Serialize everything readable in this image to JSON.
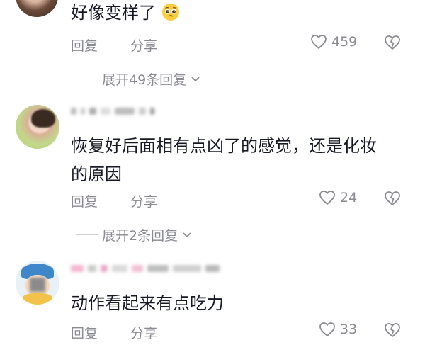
{
  "comments": [
    {
      "text": "好像变样了",
      "emoji": "pleading-face-emoji",
      "reply_label": "回复",
      "share_label": "分享",
      "likes": "459",
      "expand_label": "展开49条回复"
    },
    {
      "text_line1": "恢复好后面相有点凶了的感觉，还是化妆",
      "text_line2": "的原因",
      "reply_label": "回复",
      "share_label": "分享",
      "likes": "24",
      "expand_label": "展开2条回复"
    },
    {
      "text": "动作看起来有点吃力",
      "reply_label": "回复",
      "share_label": "分享",
      "likes": "33"
    }
  ],
  "colors": {
    "text": "#161823",
    "secondary": "#8a8b91"
  }
}
